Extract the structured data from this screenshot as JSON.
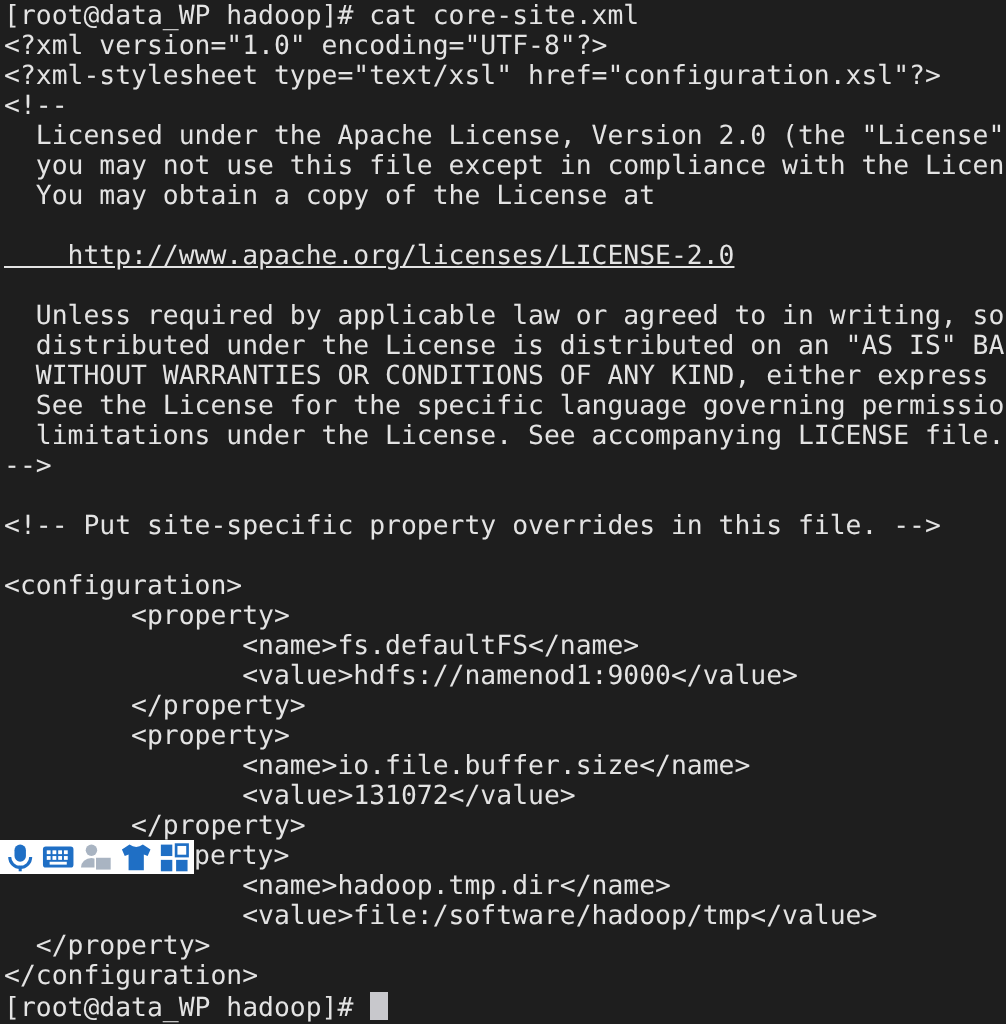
{
  "terminal": {
    "lines": [
      {
        "kind": "text",
        "text": "[root@data_WP hadoop]# cat core-site.xml"
      },
      {
        "kind": "text",
        "text": "<?xml version=\"1.0\" encoding=\"UTF-8\"?>"
      },
      {
        "kind": "text",
        "text": "<?xml-stylesheet type=\"text/xsl\" href=\"configuration.xsl\"?>"
      },
      {
        "kind": "text",
        "text": "<!--"
      },
      {
        "kind": "text",
        "text": "  Licensed under the Apache License, Version 2.0 (the \"License\""
      },
      {
        "kind": "text",
        "text": "  you may not use this file except in compliance with the Licen"
      },
      {
        "kind": "text",
        "text": "  You may obtain a copy of the License at"
      },
      {
        "kind": "blank"
      },
      {
        "kind": "link",
        "text": "    http://www.apache.org/licenses/LICENSE-2.0"
      },
      {
        "kind": "blank"
      },
      {
        "kind": "text",
        "text": "  Unless required by applicable law or agreed to in writing, so"
      },
      {
        "kind": "text",
        "text": "  distributed under the License is distributed on an \"AS IS\" BA"
      },
      {
        "kind": "text",
        "text": "  WITHOUT WARRANTIES OR CONDITIONS OF ANY KIND, either express"
      },
      {
        "kind": "text",
        "text": "  See the License for the specific language governing permissio"
      },
      {
        "kind": "text",
        "text": "  limitations under the License. See accompanying LICENSE file."
      },
      {
        "kind": "text",
        "text": "-->"
      },
      {
        "kind": "blank"
      },
      {
        "kind": "text",
        "text": "<!-- Put site-specific property overrides in this file. -->"
      },
      {
        "kind": "blank"
      },
      {
        "kind": "text",
        "text": "<configuration>"
      },
      {
        "kind": "text",
        "text": "        <property>"
      },
      {
        "kind": "text",
        "text": "               <name>fs.defaultFS</name>"
      },
      {
        "kind": "text",
        "text": "               <value>hdfs://namenod1:9000</value>"
      },
      {
        "kind": "text",
        "text": "        </property>"
      },
      {
        "kind": "text",
        "text": "        <property>"
      },
      {
        "kind": "text",
        "text": "               <name>io.file.buffer.size</name>"
      },
      {
        "kind": "text",
        "text": "               <value>131072</value>"
      },
      {
        "kind": "text",
        "text": "        </property>"
      },
      {
        "kind": "toolbar",
        "text": "perty>"
      },
      {
        "kind": "text",
        "text": "               <name>hadoop.tmp.dir</name>"
      },
      {
        "kind": "text",
        "text": "               <value>file:/software/hadoop/tmp</value>"
      },
      {
        "kind": "text",
        "text": "  </property>"
      },
      {
        "kind": "text",
        "text": "</configuration>"
      },
      {
        "kind": "prompt",
        "text": "[root@data_WP hadoop]# "
      }
    ]
  }
}
